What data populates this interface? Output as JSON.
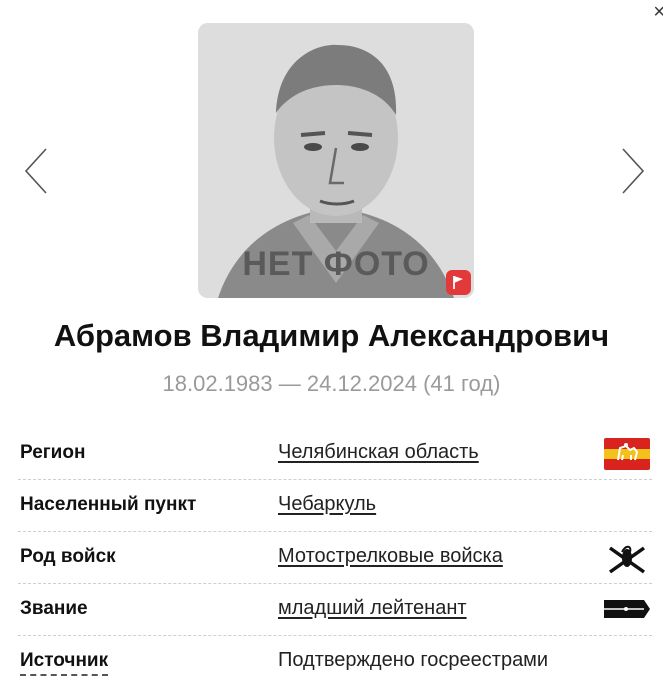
{
  "dialog": {
    "close_glyph": "×"
  },
  "photo": {
    "placeholder_text": "НЕТ ФОТО"
  },
  "person": {
    "name": "Абрамов Владимир Александрович",
    "dates": "18.02.1983 — 24.12.2024 (41 год)"
  },
  "details": [
    {
      "label": "Регион",
      "value": "Челябинская область",
      "link": true,
      "icon": "region-flag-icon"
    },
    {
      "label": "Населенный пункт",
      "value": "Чебаркуль",
      "link": true,
      "icon": null
    },
    {
      "label": "Род войск",
      "value": "Мотострелковые войска",
      "link": true,
      "icon": "motor-rifle-emblem-icon"
    },
    {
      "label": "Звание",
      "value": "младший лейтенант",
      "link": true,
      "icon": "rank-insignia-icon"
    },
    {
      "label": "Источник",
      "value": "Подтверждено госреестрами",
      "link": false,
      "icon": null
    }
  ],
  "colors": {
    "accent_red": "#e23a3a",
    "flag_red": "#d8231f",
    "flag_yellow": "#f2c21b",
    "muted": "#9a9a9a"
  }
}
